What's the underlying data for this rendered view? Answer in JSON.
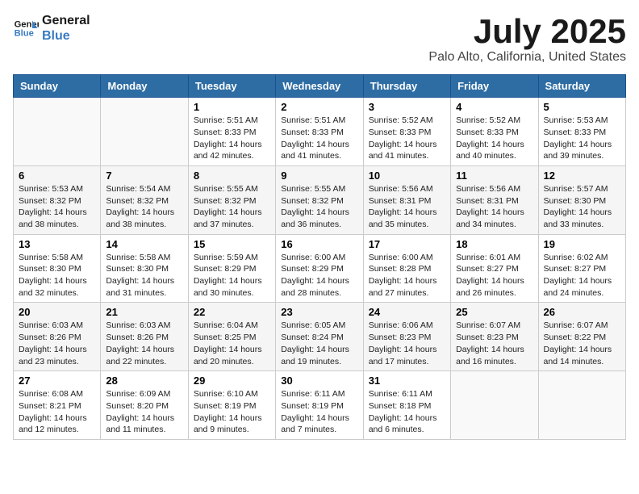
{
  "logo": {
    "line1": "General",
    "line2": "Blue"
  },
  "title": "July 2025",
  "subtitle": "Palo Alto, California, United States",
  "days_of_week": [
    "Sunday",
    "Monday",
    "Tuesday",
    "Wednesday",
    "Thursday",
    "Friday",
    "Saturday"
  ],
  "weeks": [
    [
      {
        "day": "",
        "info": ""
      },
      {
        "day": "",
        "info": ""
      },
      {
        "day": "1",
        "info": "Sunrise: 5:51 AM\nSunset: 8:33 PM\nDaylight: 14 hours and 42 minutes."
      },
      {
        "day": "2",
        "info": "Sunrise: 5:51 AM\nSunset: 8:33 PM\nDaylight: 14 hours and 41 minutes."
      },
      {
        "day": "3",
        "info": "Sunrise: 5:52 AM\nSunset: 8:33 PM\nDaylight: 14 hours and 41 minutes."
      },
      {
        "day": "4",
        "info": "Sunrise: 5:52 AM\nSunset: 8:33 PM\nDaylight: 14 hours and 40 minutes."
      },
      {
        "day": "5",
        "info": "Sunrise: 5:53 AM\nSunset: 8:33 PM\nDaylight: 14 hours and 39 minutes."
      }
    ],
    [
      {
        "day": "6",
        "info": "Sunrise: 5:53 AM\nSunset: 8:32 PM\nDaylight: 14 hours and 38 minutes."
      },
      {
        "day": "7",
        "info": "Sunrise: 5:54 AM\nSunset: 8:32 PM\nDaylight: 14 hours and 38 minutes."
      },
      {
        "day": "8",
        "info": "Sunrise: 5:55 AM\nSunset: 8:32 PM\nDaylight: 14 hours and 37 minutes."
      },
      {
        "day": "9",
        "info": "Sunrise: 5:55 AM\nSunset: 8:32 PM\nDaylight: 14 hours and 36 minutes."
      },
      {
        "day": "10",
        "info": "Sunrise: 5:56 AM\nSunset: 8:31 PM\nDaylight: 14 hours and 35 minutes."
      },
      {
        "day": "11",
        "info": "Sunrise: 5:56 AM\nSunset: 8:31 PM\nDaylight: 14 hours and 34 minutes."
      },
      {
        "day": "12",
        "info": "Sunrise: 5:57 AM\nSunset: 8:30 PM\nDaylight: 14 hours and 33 minutes."
      }
    ],
    [
      {
        "day": "13",
        "info": "Sunrise: 5:58 AM\nSunset: 8:30 PM\nDaylight: 14 hours and 32 minutes."
      },
      {
        "day": "14",
        "info": "Sunrise: 5:58 AM\nSunset: 8:30 PM\nDaylight: 14 hours and 31 minutes."
      },
      {
        "day": "15",
        "info": "Sunrise: 5:59 AM\nSunset: 8:29 PM\nDaylight: 14 hours and 30 minutes."
      },
      {
        "day": "16",
        "info": "Sunrise: 6:00 AM\nSunset: 8:29 PM\nDaylight: 14 hours and 28 minutes."
      },
      {
        "day": "17",
        "info": "Sunrise: 6:00 AM\nSunset: 8:28 PM\nDaylight: 14 hours and 27 minutes."
      },
      {
        "day": "18",
        "info": "Sunrise: 6:01 AM\nSunset: 8:27 PM\nDaylight: 14 hours and 26 minutes."
      },
      {
        "day": "19",
        "info": "Sunrise: 6:02 AM\nSunset: 8:27 PM\nDaylight: 14 hours and 24 minutes."
      }
    ],
    [
      {
        "day": "20",
        "info": "Sunrise: 6:03 AM\nSunset: 8:26 PM\nDaylight: 14 hours and 23 minutes."
      },
      {
        "day": "21",
        "info": "Sunrise: 6:03 AM\nSunset: 8:26 PM\nDaylight: 14 hours and 22 minutes."
      },
      {
        "day": "22",
        "info": "Sunrise: 6:04 AM\nSunset: 8:25 PM\nDaylight: 14 hours and 20 minutes."
      },
      {
        "day": "23",
        "info": "Sunrise: 6:05 AM\nSunset: 8:24 PM\nDaylight: 14 hours and 19 minutes."
      },
      {
        "day": "24",
        "info": "Sunrise: 6:06 AM\nSunset: 8:23 PM\nDaylight: 14 hours and 17 minutes."
      },
      {
        "day": "25",
        "info": "Sunrise: 6:07 AM\nSunset: 8:23 PM\nDaylight: 14 hours and 16 minutes."
      },
      {
        "day": "26",
        "info": "Sunrise: 6:07 AM\nSunset: 8:22 PM\nDaylight: 14 hours and 14 minutes."
      }
    ],
    [
      {
        "day": "27",
        "info": "Sunrise: 6:08 AM\nSunset: 8:21 PM\nDaylight: 14 hours and 12 minutes."
      },
      {
        "day": "28",
        "info": "Sunrise: 6:09 AM\nSunset: 8:20 PM\nDaylight: 14 hours and 11 minutes."
      },
      {
        "day": "29",
        "info": "Sunrise: 6:10 AM\nSunset: 8:19 PM\nDaylight: 14 hours and 9 minutes."
      },
      {
        "day": "30",
        "info": "Sunrise: 6:11 AM\nSunset: 8:19 PM\nDaylight: 14 hours and 7 minutes."
      },
      {
        "day": "31",
        "info": "Sunrise: 6:11 AM\nSunset: 8:18 PM\nDaylight: 14 hours and 6 minutes."
      },
      {
        "day": "",
        "info": ""
      },
      {
        "day": "",
        "info": ""
      }
    ]
  ]
}
